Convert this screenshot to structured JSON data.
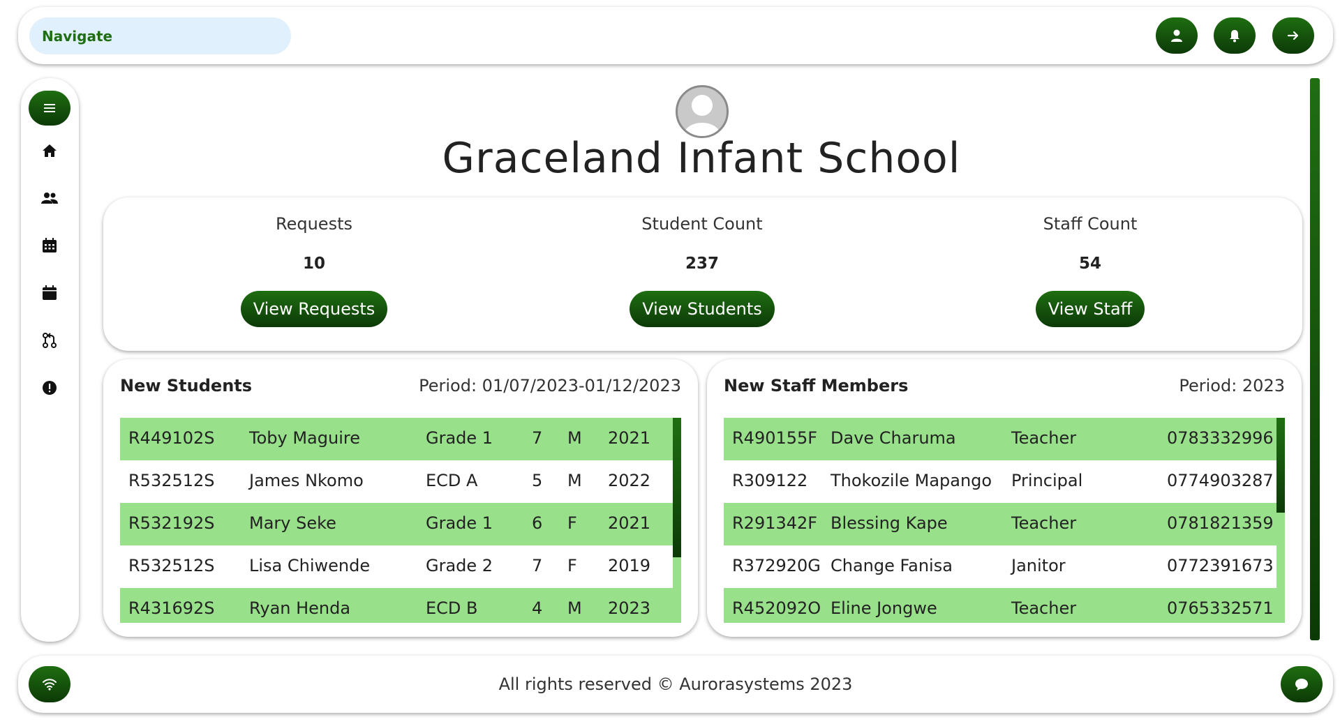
{
  "topbar": {
    "navigate_placeholder": "Navigate",
    "actions": [
      {
        "icon": "user-icon"
      },
      {
        "icon": "bell-icon"
      },
      {
        "icon": "arrow-right-icon"
      }
    ]
  },
  "sidebar": {
    "items": [
      {
        "icon": "menu-icon"
      },
      {
        "icon": "home-icon"
      },
      {
        "icon": "users-icon"
      },
      {
        "icon": "calendar-grid-icon"
      },
      {
        "icon": "calendar-icon"
      },
      {
        "icon": "pull-request-icon"
      },
      {
        "icon": "alert-circle-icon"
      }
    ]
  },
  "school": {
    "name": "Graceland Infant School"
  },
  "stats": [
    {
      "label": "Requests",
      "value": "10",
      "button": "View Requests"
    },
    {
      "label": "Student Count",
      "value": "237",
      "button": "View Students"
    },
    {
      "label": "Staff Count",
      "value": "54",
      "button": "View Staff"
    }
  ],
  "new_students": {
    "title": "New Students",
    "period": "Period: 01/07/2023-01/12/2023",
    "rows": [
      [
        "R449102S",
        "Toby Maguire",
        "Grade 1",
        "7",
        "M",
        "2021"
      ],
      [
        "R532512S",
        "James Nkomo",
        "ECD A",
        "5",
        "M",
        "2022"
      ],
      [
        "R532192S",
        "Mary Seke",
        "Grade 1",
        "6",
        "F",
        "2021"
      ],
      [
        "R532512S",
        "Lisa Chiwende",
        "Grade 2",
        "7",
        "F",
        "2019"
      ],
      [
        "R431692S",
        "Ryan Henda",
        "ECD B",
        "4",
        "M",
        "2023"
      ]
    ]
  },
  "new_staff": {
    "title": "New Staff Members",
    "period": "Period: 2023",
    "rows": [
      [
        "R490155F",
        "Dave Charuma",
        "Teacher",
        "0783332996"
      ],
      [
        "R309122",
        "Thokozile Mapango",
        "Principal",
        "0774903287"
      ],
      [
        "R291342F",
        "Blessing Kape",
        "Teacher",
        "0781821359"
      ],
      [
        "R372920G",
        "Change Fanisa",
        "Janitor",
        "0772391673"
      ],
      [
        "R452092O",
        "Eline Jongwe",
        "Teacher",
        "0765332571"
      ]
    ]
  },
  "footer": {
    "text": "All rights reserved © Aurorasystems 2023",
    "left_icon": "wifi-icon",
    "right_icon": "chat-icon"
  },
  "colors": {
    "accent_dark": "#0c3a06",
    "accent": "#1f6e12",
    "row_highlight": "#98e08a",
    "nav_bg": "#e0f0fc"
  }
}
